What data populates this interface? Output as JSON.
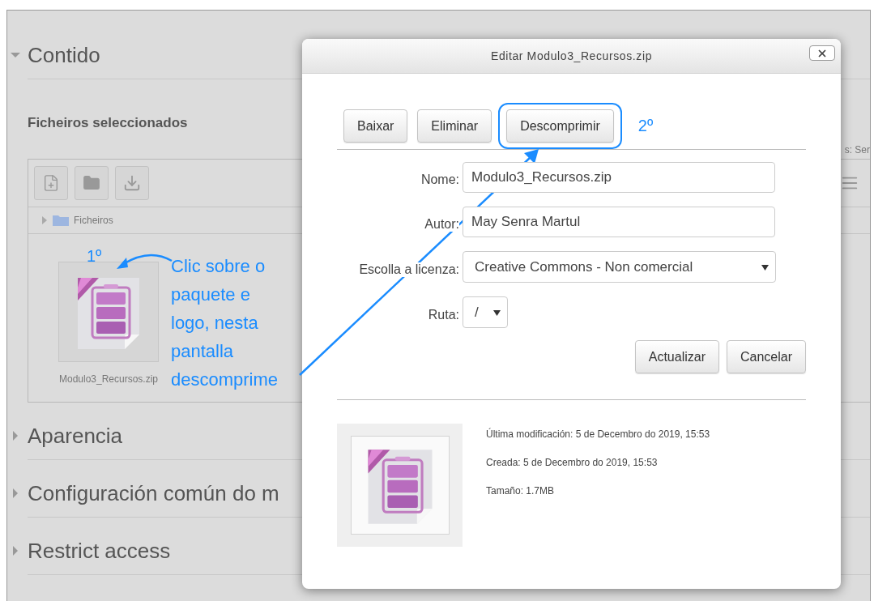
{
  "sections": [
    {
      "title": "Contido",
      "expanded": true
    },
    {
      "title": "Aparencia",
      "expanded": false
    },
    {
      "title": "Configuración común do m",
      "expanded": false
    },
    {
      "title": "Restrict access",
      "expanded": false
    }
  ],
  "file_manager": {
    "label": "Ficheiros seleccionados",
    "side_text": "s: Ser",
    "path": "Ficheiros",
    "files": [
      {
        "name": "Modulo3_Recursos.zip"
      }
    ]
  },
  "dialog": {
    "title": "Editar Modulo3_Recursos.zip",
    "actions": [
      {
        "label": "Baixar",
        "highlighted": false
      },
      {
        "label": "Eliminar",
        "highlighted": false
      },
      {
        "label": "Descomprimir",
        "highlighted": true
      }
    ],
    "fields": [
      {
        "kind": "text",
        "label": "Nome:",
        "value": "Modulo3_Recursos.zip"
      },
      {
        "kind": "text",
        "label": "Autor:",
        "value": "May Senra Martul"
      },
      {
        "kind": "select",
        "label": "Escolla a licenza:",
        "value": "Creative Commons - Non comercial"
      },
      {
        "kind": "small-select",
        "label": "Ruta:",
        "value": "/"
      }
    ],
    "buttons": [
      "Actualizar",
      "Cancelar"
    ],
    "info": [
      "Última modificación: 5 de Decembro do 2019, 15:53",
      "Creada: 5 de Decembro do 2019, 15:53",
      "Tamaño: 1.7MB"
    ]
  },
  "annotations": {
    "step1": "1º",
    "step2": "2º",
    "note": "Clic sobre o paquete e logo, nesta pantalla descomprime"
  }
}
